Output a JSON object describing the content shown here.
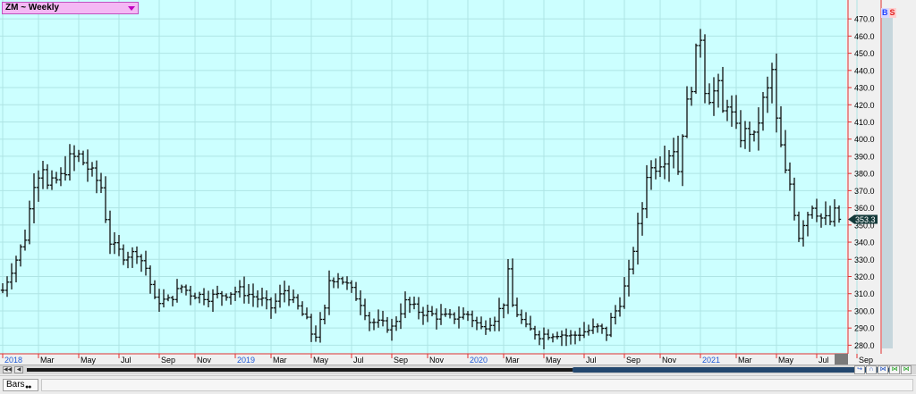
{
  "window": {
    "symbol_label": "ZM ~ Weekly",
    "symbol_dropdown_icon": "triangle-down-icon",
    "badge_b": "B",
    "badge_s": "S",
    "status_tab_label": "Bars",
    "colors": {
      "plot_bg": "#ccffff",
      "grid": "#aee4e4",
      "axis_red": "#e03030",
      "bar": "#111111",
      "price_tag_bg": "#143a3a",
      "month_label": "#000000",
      "year_label": "#1e5ad6"
    }
  },
  "chart_data": {
    "type": "ohlc",
    "title": "",
    "xlabel": "",
    "ylabel": "",
    "interval": "Weekly",
    "ylim": [
      275,
      481
    ],
    "y_ticks": [
      280,
      290,
      300,
      310,
      320,
      330,
      340,
      350,
      360,
      370,
      380,
      390,
      400,
      410,
      420,
      430,
      440,
      450,
      460,
      470
    ],
    "y_tick_labels": [
      "280.0",
      "290.0",
      "300.0",
      "310.0",
      "320.0",
      "330.0",
      "340.0",
      "350.0",
      "360.0",
      "370.0",
      "380.0",
      "390.0",
      "400.0",
      "410.0",
      "420.0",
      "430.0",
      "440.0",
      "450.0",
      "460.0",
      "470.0"
    ],
    "last_price": 353.3,
    "last_price_label": "353.3",
    "x_axis_labels": [
      {
        "text": "2018",
        "kind": "year",
        "week": 0
      },
      {
        "text": "Mar",
        "kind": "month",
        "week": 8
      },
      {
        "text": "May",
        "kind": "month",
        "week": 17
      },
      {
        "text": "Jul",
        "kind": "month",
        "week": 26
      },
      {
        "text": "Sep",
        "kind": "month",
        "week": 35
      },
      {
        "text": "Nov",
        "kind": "month",
        "week": 43
      },
      {
        "text": "2019",
        "kind": "year",
        "week": 52
      },
      {
        "text": "Mar",
        "kind": "month",
        "week": 60
      },
      {
        "text": "May",
        "kind": "month",
        "week": 69
      },
      {
        "text": "Jul",
        "kind": "month",
        "week": 78
      },
      {
        "text": "Sep",
        "kind": "month",
        "week": 87
      },
      {
        "text": "Nov",
        "kind": "month",
        "week": 95
      },
      {
        "text": "2020",
        "kind": "year",
        "week": 104
      },
      {
        "text": "Mar",
        "kind": "month",
        "week": 112
      },
      {
        "text": "May",
        "kind": "month",
        "week": 121
      },
      {
        "text": "Jul",
        "kind": "month",
        "week": 130
      },
      {
        "text": "Sep",
        "kind": "month",
        "week": 139
      },
      {
        "text": "Nov",
        "kind": "month",
        "week": 147
      },
      {
        "text": "2021",
        "kind": "year",
        "week": 156
      },
      {
        "text": "Mar",
        "kind": "month",
        "week": 164
      },
      {
        "text": "May",
        "kind": "month",
        "week": 173
      },
      {
        "text": "Jul",
        "kind": "month",
        "week": 182
      },
      {
        "text": "Sep",
        "kind": "month",
        "week": 191
      }
    ],
    "anchors": [
      [
        0,
        312
      ],
      [
        3,
        330
      ],
      [
        5,
        343
      ],
      [
        7,
        375
      ],
      [
        9,
        385
      ],
      [
        10,
        372
      ],
      [
        13,
        378
      ],
      [
        15,
        388
      ],
      [
        17,
        390
      ],
      [
        20,
        380
      ],
      [
        22,
        372
      ],
      [
        23,
        355
      ],
      [
        24,
        340
      ],
      [
        27,
        332
      ],
      [
        30,
        334
      ],
      [
        32,
        325
      ],
      [
        34,
        306
      ],
      [
        37,
        306
      ],
      [
        40,
        314
      ],
      [
        42,
        310
      ],
      [
        46,
        308
      ],
      [
        50,
        310
      ],
      [
        53,
        312
      ],
      [
        58,
        306
      ],
      [
        60,
        302
      ],
      [
        63,
        312
      ],
      [
        66,
        302
      ],
      [
        68,
        294
      ],
      [
        69,
        287
      ],
      [
        70,
        286
      ],
      [
        72,
        300
      ],
      [
        73,
        318
      ],
      [
        75,
        320
      ],
      [
        77,
        315
      ],
      [
        80,
        305
      ],
      [
        82,
        294
      ],
      [
        85,
        292
      ],
      [
        87,
        290
      ],
      [
        90,
        305
      ],
      [
        93,
        300
      ],
      [
        97,
        297
      ],
      [
        100,
        296
      ],
      [
        104,
        298
      ],
      [
        107,
        290
      ],
      [
        110,
        296
      ],
      [
        112,
        305
      ],
      [
        113,
        322
      ],
      [
        114,
        303
      ],
      [
        117,
        290
      ],
      [
        120,
        286
      ],
      [
        124,
        287
      ],
      [
        127,
        285
      ],
      [
        130,
        288
      ],
      [
        133,
        290
      ],
      [
        135,
        287
      ],
      [
        136,
        295
      ],
      [
        138,
        305
      ],
      [
        140,
        322
      ],
      [
        141,
        336
      ],
      [
        143,
        360
      ],
      [
        144,
        380
      ],
      [
        146,
        385
      ],
      [
        148,
        390
      ],
      [
        150,
        395
      ],
      [
        151,
        382
      ],
      [
        152,
        405
      ],
      [
        153,
        420
      ],
      [
        154,
        432
      ],
      [
        155,
        450
      ],
      [
        156,
        460
      ],
      [
        157,
        430
      ],
      [
        158,
        425
      ],
      [
        160,
        430
      ],
      [
        161,
        415
      ],
      [
        162,
        422
      ],
      [
        164,
        405
      ],
      [
        165,
        402
      ],
      [
        167,
        405
      ],
      [
        168,
        400
      ],
      [
        170,
        422
      ],
      [
        171,
        428
      ],
      [
        172,
        440
      ],
      [
        173,
        410
      ],
      [
        174,
        395
      ],
      [
        175,
        380
      ],
      [
        176,
        374
      ],
      [
        177,
        358
      ],
      [
        178,
        344
      ],
      [
        179,
        352
      ],
      [
        181,
        362
      ],
      [
        183,
        354
      ],
      [
        185,
        352
      ],
      [
        186,
        357
      ],
      [
        187,
        353.3
      ]
    ],
    "total_weeks": 188
  }
}
